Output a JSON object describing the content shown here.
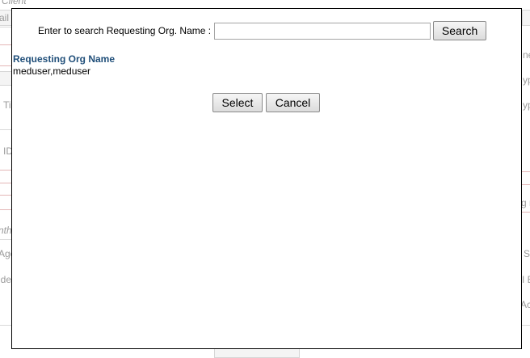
{
  "background": {
    "fragments": [
      {
        "id": "client",
        "text": "Client"
      },
      {
        "id": "ail",
        "text": "ail"
      },
      {
        "id": "ti",
        "text": "Ti"
      },
      {
        "id": "id",
        "text": "ID"
      },
      {
        "id": "nth",
        "text": "nth"
      },
      {
        "id": "age",
        "text": "Age"
      },
      {
        "id": "ide",
        "text": "ide"
      },
      {
        "id": "ne",
        "text": "ne"
      },
      {
        "id": "yp1",
        "text": "yp"
      },
      {
        "id": "yp2",
        "text": "yp"
      },
      {
        "id": "gn",
        "text": "g n"
      },
      {
        "id": "s",
        "text": "S"
      },
      {
        "id": "ie",
        "text": "I E"
      },
      {
        "id": "ac",
        "text": "Ac"
      }
    ]
  },
  "dialog": {
    "search_label": "Enter to search Requesting Org. Name :",
    "search_value": "",
    "search_button": "Search",
    "column_header": "Requesting Org Name",
    "results": [
      "meduser,meduser"
    ],
    "select_button": "Select",
    "cancel_button": "Cancel"
  }
}
